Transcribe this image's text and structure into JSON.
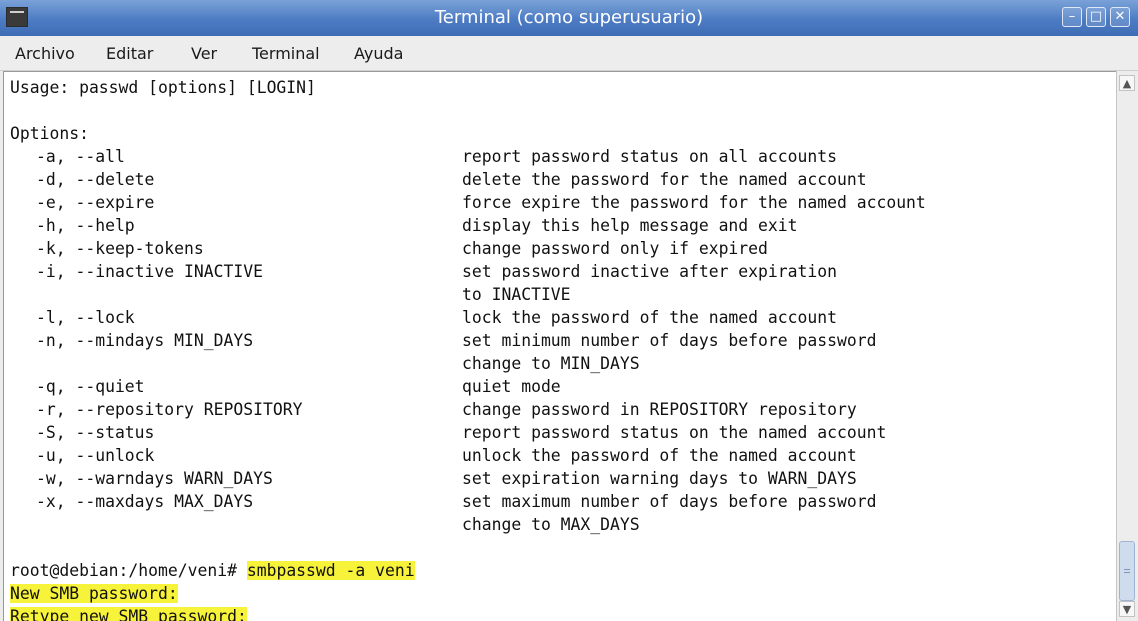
{
  "window": {
    "title": "Terminal (como superusuario)",
    "controls": {
      "minimize": "–",
      "maximize": "□",
      "close": "✕"
    }
  },
  "menu": [
    "Archivo",
    "Editar",
    "Ver",
    "Terminal",
    "Ayuda"
  ],
  "terminal": {
    "usage": "Usage: passwd [options] [LOGIN]",
    "options_header": "Options:",
    "options": [
      {
        "flag": "-a, --all",
        "desc": "report password status on all accounts"
      },
      {
        "flag": "-d, --delete",
        "desc": "delete the password for the named account"
      },
      {
        "flag": "-e, --expire",
        "desc": "force expire the password for the named account"
      },
      {
        "flag": "-h, --help",
        "desc": "display this help message and exit"
      },
      {
        "flag": "-k, --keep-tokens",
        "desc": "change password only if expired"
      },
      {
        "flag": "-i, --inactive INACTIVE",
        "desc": "set password inactive after expiration"
      },
      {
        "flag": "",
        "desc": "to INACTIVE"
      },
      {
        "flag": "-l, --lock",
        "desc": "lock the password of the named account"
      },
      {
        "flag": "-n, --mindays MIN_DAYS",
        "desc": "set minimum number of days before password"
      },
      {
        "flag": "",
        "desc": "change to MIN_DAYS"
      },
      {
        "flag": "-q, --quiet",
        "desc": "quiet mode"
      },
      {
        "flag": "-r, --repository REPOSITORY",
        "desc": "change password in REPOSITORY repository"
      },
      {
        "flag": "-S, --status",
        "desc": "report password status on the named account"
      },
      {
        "flag": "-u, --unlock",
        "desc": "unlock the password of the named account"
      },
      {
        "flag": "-w, --warndays WARN_DAYS",
        "desc": "set expiration warning days to WARN_DAYS"
      },
      {
        "flag": "-x, --maxdays MAX_DAYS",
        "desc": "set maximum number of days before password"
      },
      {
        "flag": "",
        "desc": "change to MAX_DAYS"
      }
    ],
    "prompt": "root@debian:/home/veni# ",
    "command": "smbpasswd -a veni",
    "output": [
      "New SMB password:",
      "Retype new SMB password:"
    ]
  },
  "scrollbar": {
    "up_icon": "▲",
    "down_icon": "▼"
  },
  "colors": {
    "titlebar": "#4d7cc4",
    "highlight": "#f7f23a"
  }
}
